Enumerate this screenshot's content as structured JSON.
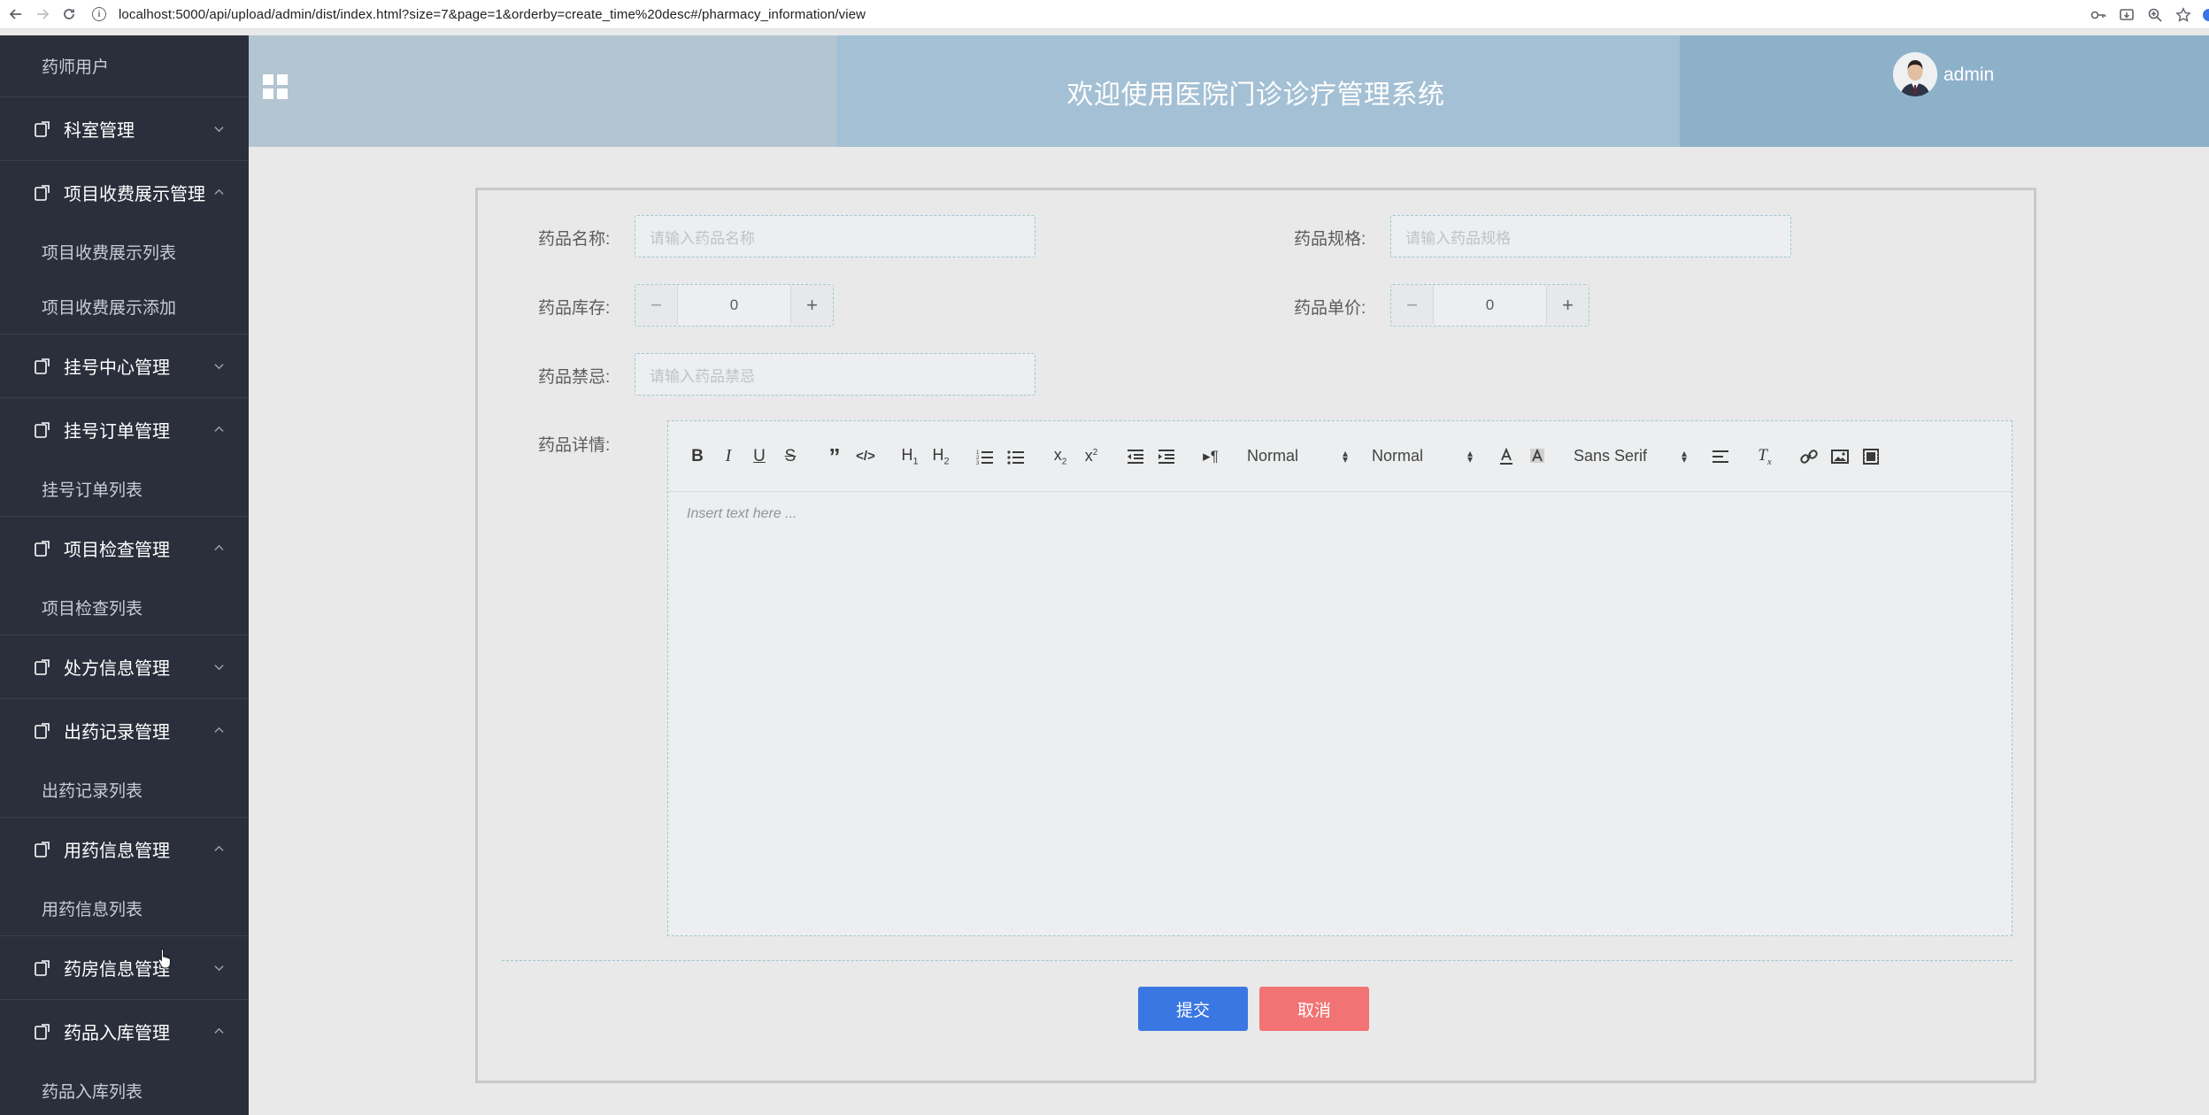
{
  "browser": {
    "url": "localhost:5000/api/upload/admin/dist/index.html?size=7&page=1&orderby=create_time%20desc#/pharmacy_information/view"
  },
  "sidebar": {
    "top_item": "药师用户",
    "groups": [
      {
        "label": "科室管理",
        "expanded": false,
        "children": []
      },
      {
        "label": "项目收费展示管理",
        "expanded": true,
        "children": [
          "项目收费展示列表",
          "项目收费展示添加"
        ]
      },
      {
        "label": "挂号中心管理",
        "expanded": false,
        "children": []
      },
      {
        "label": "挂号订单管理",
        "expanded": true,
        "children": [
          "挂号订单列表"
        ]
      },
      {
        "label": "项目检查管理",
        "expanded": true,
        "children": [
          "项目检查列表"
        ]
      },
      {
        "label": "处方信息管理",
        "expanded": false,
        "children": []
      },
      {
        "label": "出药记录管理",
        "expanded": true,
        "children": [
          "出药记录列表"
        ]
      },
      {
        "label": "用药信息管理",
        "expanded": true,
        "children": [
          "用药信息列表"
        ]
      },
      {
        "label": "药房信息管理",
        "expanded": false,
        "children": []
      },
      {
        "label": "药品入库管理",
        "expanded": true,
        "children": [
          "药品入库列表"
        ]
      }
    ]
  },
  "header": {
    "title": "欢迎使用医院门诊诊疗管理系统",
    "username": "admin"
  },
  "form": {
    "name_label": "药品名称:",
    "name_placeholder": "请输入药品名称",
    "spec_label": "药品规格:",
    "spec_placeholder": "请输入药品规格",
    "stock_label": "药品库存:",
    "stock_value": "0",
    "price_label": "药品单价:",
    "price_value": "0",
    "taboo_label": "药品禁忌:",
    "taboo_placeholder": "请输入药品禁忌",
    "detail_label": "药品详情:",
    "editor_placeholder": "Insert text here ...",
    "submit_label": "提交",
    "cancel_label": "取消"
  },
  "toolbar": {
    "header_picker": "Normal",
    "size_picker": "Normal",
    "font_picker": "Sans Serif"
  },
  "colors": {
    "sidebar_bg": "#2b2f3c",
    "header_left": "#b4c5d2",
    "header_mid": "#a4c0d4",
    "header_right": "#8eb1ca",
    "submit_bg": "#3b77e2",
    "cancel_bg": "#f27373"
  }
}
